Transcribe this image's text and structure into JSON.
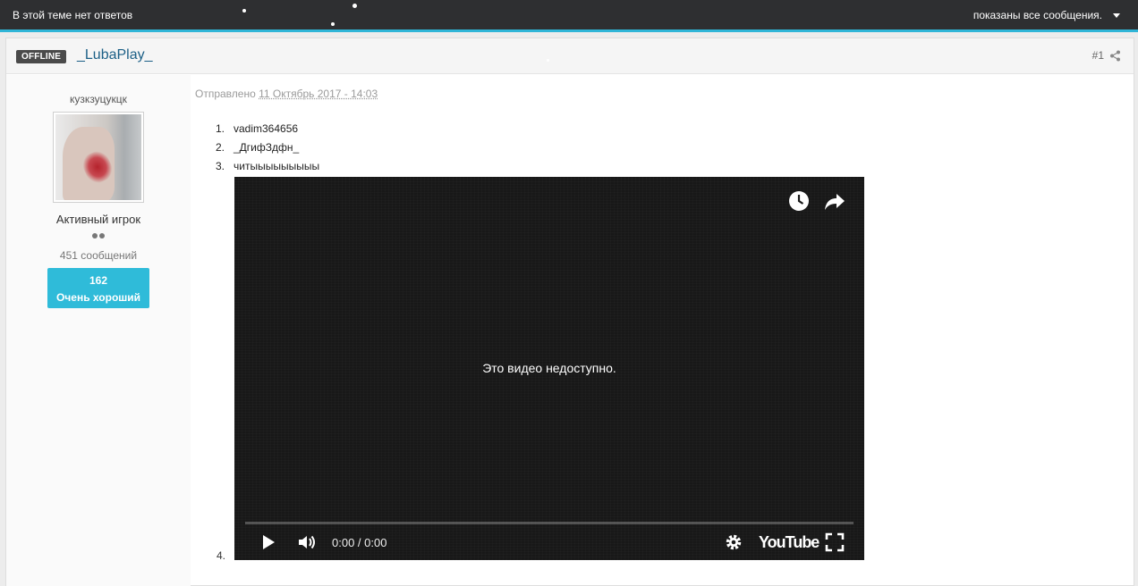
{
  "topbar": {
    "status": "В этой теме нет ответов",
    "filter": "показаны все сообщения."
  },
  "post": {
    "badge": "OFFLINE",
    "author": "_LubaPlay_",
    "number": "#1",
    "posted_prefix": "Отправлено",
    "posted_date": "11 Октябрь 2017 - 14:03",
    "list": [
      {
        "n": "1.",
        "text": "vadim364656"
      },
      {
        "n": "2.",
        "text": "_ДгифЗдфн_"
      },
      {
        "n": "3.",
        "text": "читыыыыыыыыы"
      },
      {
        "n": "4.",
        "text": ""
      }
    ]
  },
  "sidebar": {
    "username": "кузкзуцукцк",
    "rank": "Активный игрок",
    "post_count": "451 сообщений",
    "reputation_value": "162",
    "reputation_label": "Очень хороший"
  },
  "video": {
    "message": "Это видео недоступно.",
    "time": "0:00 / 0:00",
    "brand": "YouTube"
  },
  "colors": {
    "accent": "#2fbbd9",
    "topbar": "#2e2f31",
    "author_link": "#1b5f86"
  }
}
